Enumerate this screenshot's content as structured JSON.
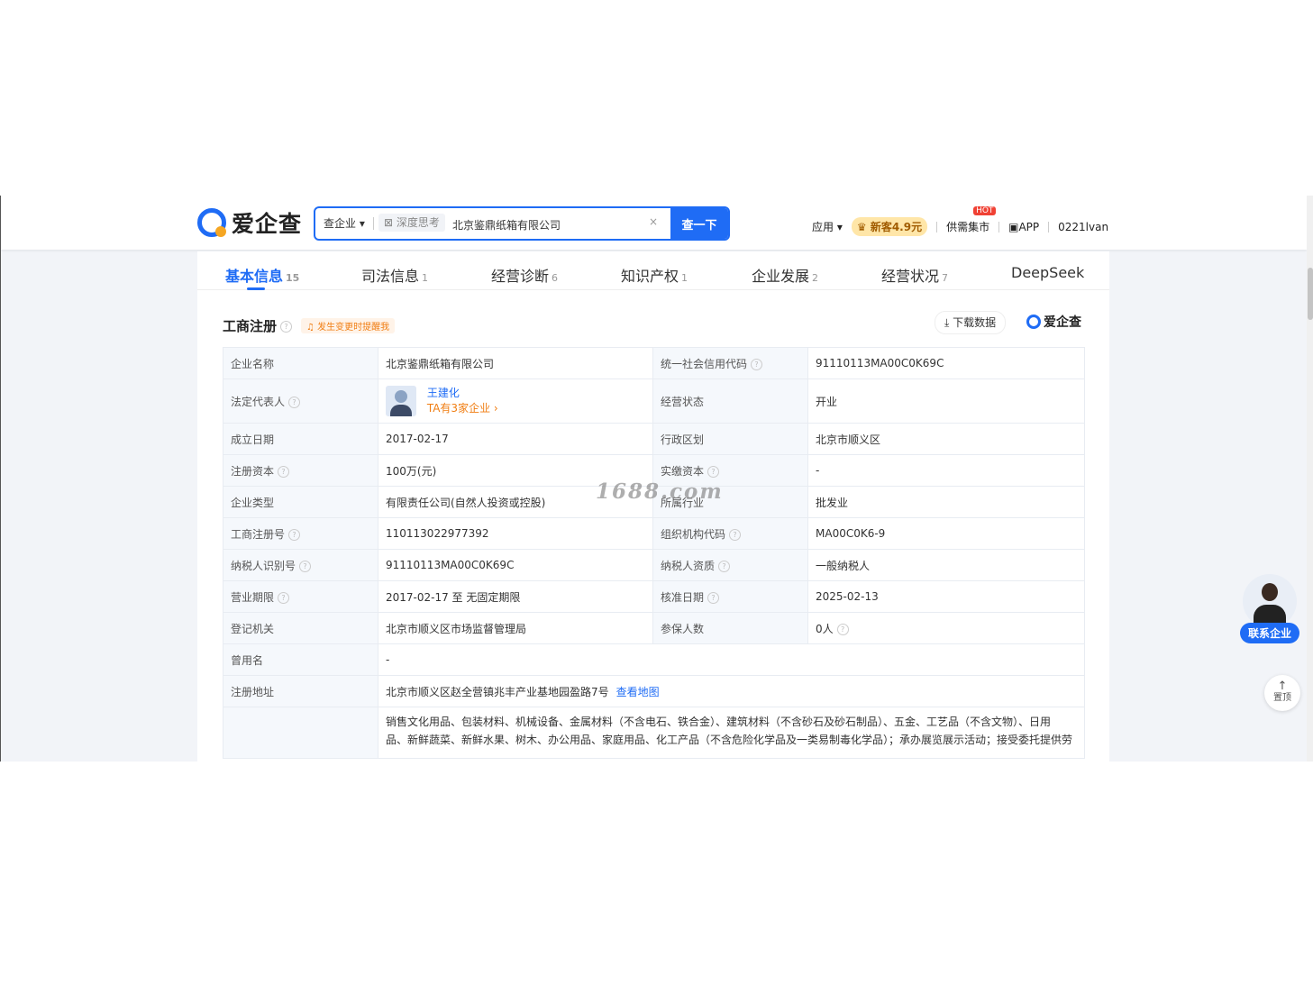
{
  "header": {
    "logo_text": "爱企查",
    "search": {
      "scope": "查企业",
      "deep_think": "深度思考",
      "query": "北京鉴鼎纸箱有限公司",
      "clear": "×",
      "button": "查一下"
    },
    "nav": {
      "apps": "应用",
      "vip": "新客4.9元",
      "market": "供需集市",
      "hot": "HOT",
      "app": "APP",
      "user": "0221lvan"
    }
  },
  "tabs": [
    {
      "label": "基本信息",
      "count": "15",
      "active": true
    },
    {
      "label": "司法信息",
      "count": "1"
    },
    {
      "label": "经营诊断",
      "count": "6"
    },
    {
      "label": "知识产权",
      "count": "1"
    },
    {
      "label": "企业发展",
      "count": "2"
    },
    {
      "label": "经营状况",
      "count": "7"
    },
    {
      "label": "DeepSeek",
      "count": ""
    }
  ],
  "section": {
    "title": "工商注册",
    "remind": "发生变更时提醒我",
    "download": "下载数据",
    "logo_text": "爱企查"
  },
  "info": {
    "company_name_k": "企业名称",
    "company_name_v": "北京鉴鼎纸箱有限公司",
    "credit_code_k": "统一社会信用代码",
    "credit_code_v": "91110113MA00C0K69C",
    "legal_rep_k": "法定代表人",
    "legal_rep_name": "王建化",
    "legal_rep_sub": "TA有3家企业 ›",
    "status_k": "经营状态",
    "status_v": "开业",
    "founded_k": "成立日期",
    "founded_v": "2017-02-17",
    "region_k": "行政区划",
    "region_v": "北京市顺义区",
    "reg_capital_k": "注册资本",
    "reg_capital_v": "100万(元)",
    "paid_capital_k": "实缴资本",
    "paid_capital_v": "-",
    "type_k": "企业类型",
    "type_v": "有限责任公司(自然人投资或控股)",
    "industry_k": "所属行业",
    "industry_v": "批发业",
    "reg_no_k": "工商注册号",
    "reg_no_v": "110113022977392",
    "org_code_k": "组织机构代码",
    "org_code_v": "MA00C0K6-9",
    "tax_id_k": "纳税人识别号",
    "tax_id_v": "91110113MA00C0K69C",
    "taxpayer_k": "纳税人资质",
    "taxpayer_v": "一般纳税人",
    "term_k": "营业期限",
    "term_v": "2017-02-17 至 无固定期限",
    "approve_k": "核准日期",
    "approve_v": "2025-02-13",
    "authority_k": "登记机关",
    "authority_v": "北京市顺义区市场监督管理局",
    "insured_k": "参保人数",
    "insured_v": "0人",
    "former_k": "曾用名",
    "former_v": "-",
    "address_k": "注册地址",
    "address_v": "北京市顺义区赵全营镇兆丰产业基地园盈路7号",
    "map_link": "查看地图",
    "scope_line1": "销售文化用品、包装材料、机械设备、金属材料（不含电石、铁合金）、建筑材料（不含砂石及砂石制品）、五金、工艺品（不含文物）、日用",
    "scope_line2": "品、新鲜蔬菜、新鲜水果、树木、办公用品、家庭用品、化工产品（不含危险化学品及一类易制毒化学品）；承办展览展示活动；接受委托提供劳"
  },
  "watermark": "1688.com",
  "float": {
    "contact": "联系企业",
    "to_top_arrow": "↑",
    "to_top": "置顶"
  }
}
